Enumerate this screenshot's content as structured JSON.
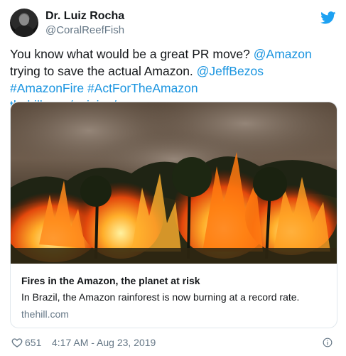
{
  "author": {
    "name": "Dr. Luiz Rocha",
    "handle": "@CoralReefFish"
  },
  "tweet": {
    "parts": [
      {
        "text": "You know what would be a great PR move? ",
        "link": false
      },
      {
        "text": "@Amazon",
        "link": true
      },
      {
        "text": " trying to save the actual Amazon. ",
        "link": false
      },
      {
        "text": "@JeffBezos",
        "link": true
      },
      {
        "text": " ",
        "link": false
      },
      {
        "text": "#AmazonFire",
        "link": true
      },
      {
        "text": " ",
        "link": false
      },
      {
        "text": "#ActForTheAmazon",
        "link": true
      },
      {
        "text": " ",
        "link": false
      },
      {
        "text": "thehill.com/opinion/energy…",
        "link": true
      }
    ]
  },
  "card": {
    "title": "Fires in the Amazon, the planet at risk",
    "description": "In Brazil, the Amazon rainforest is now burning at a record rate.",
    "domain": "thehill.com"
  },
  "footer": {
    "likes": "651",
    "timestamp": "4:17 AM - Aug 23, 2019"
  },
  "icons": {
    "brand": "twitter-bird-icon",
    "like": "heart-icon",
    "info": "info-icon"
  },
  "colors": {
    "link": "#1b95e0",
    "brand": "#1da1f2",
    "muted": "#657786"
  }
}
